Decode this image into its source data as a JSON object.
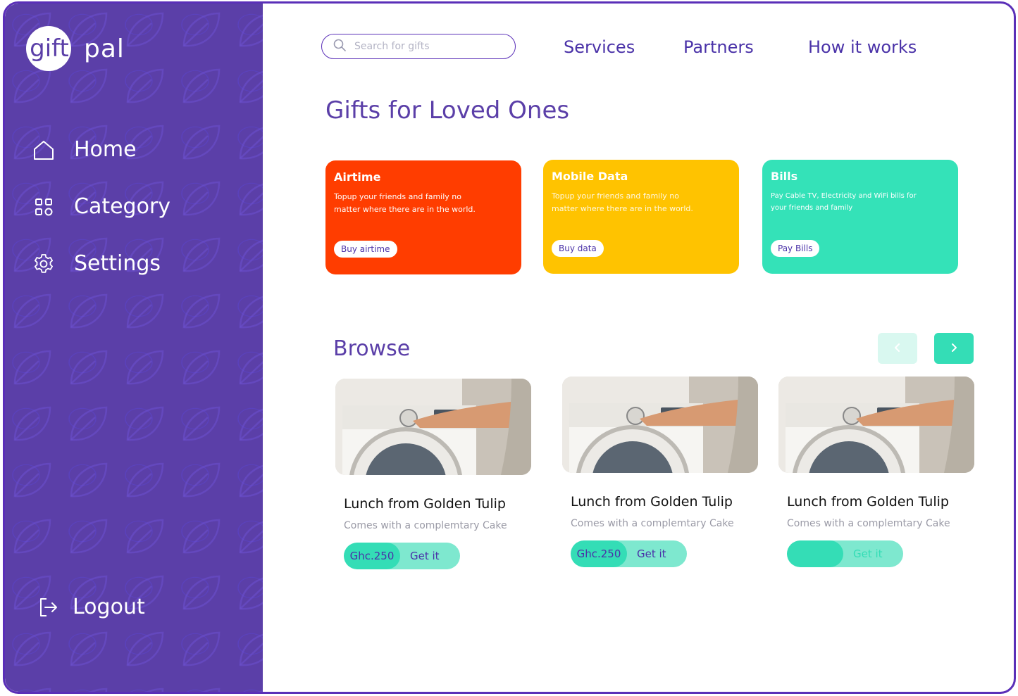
{
  "app": {
    "logo_left": "gift",
    "logo_right": "pal"
  },
  "sidebar": {
    "items": [
      {
        "label": "Home",
        "icon": "home-icon"
      },
      {
        "label": "Category",
        "icon": "grid-icon"
      },
      {
        "label": "Settings",
        "icon": "gear-icon"
      }
    ],
    "logout": {
      "label": "Logout",
      "icon": "logout-icon"
    }
  },
  "header": {
    "search_placeholder": "Search for gifts",
    "nav": [
      "Services",
      "Partners",
      "How it works"
    ]
  },
  "main": {
    "title": "Gifts for Loved Ones",
    "cards": [
      {
        "title": "Airtime",
        "description": "Topup your friends and family no matter where there are in the world.",
        "button": "Buy airtime",
        "color": "#ff3d00"
      },
      {
        "title": "Mobile Data",
        "description": "Topup your friends and family no matter where there are in the world.",
        "button": "Buy data",
        "color": "#ffc300"
      },
      {
        "title": "Bills",
        "description": "Pay Cable TV, Electricity and WiFi bills for your friends and family",
        "button": "Pay Bills",
        "color": "#34e2b8"
      }
    ],
    "browse": {
      "title": "Browse",
      "products": [
        {
          "title": "Lunch from Golden Tulip",
          "subtitle": "Comes with a complemtary Cake",
          "price": "Ghc.250",
          "action": "Get it"
        },
        {
          "title": "Lunch from Golden Tulip",
          "subtitle": "Comes with a complemtary Cake",
          "price": "Ghc.250",
          "action": "Get it"
        },
        {
          "title": "Lunch from Golden Tulip",
          "subtitle": "Comes with a complemtary Cake",
          "price": "",
          "action": "Get it"
        }
      ]
    }
  },
  "colors": {
    "purple": "#5b3fa8",
    "accent": "#34ddb6",
    "text_purple": "#4a32a8"
  }
}
